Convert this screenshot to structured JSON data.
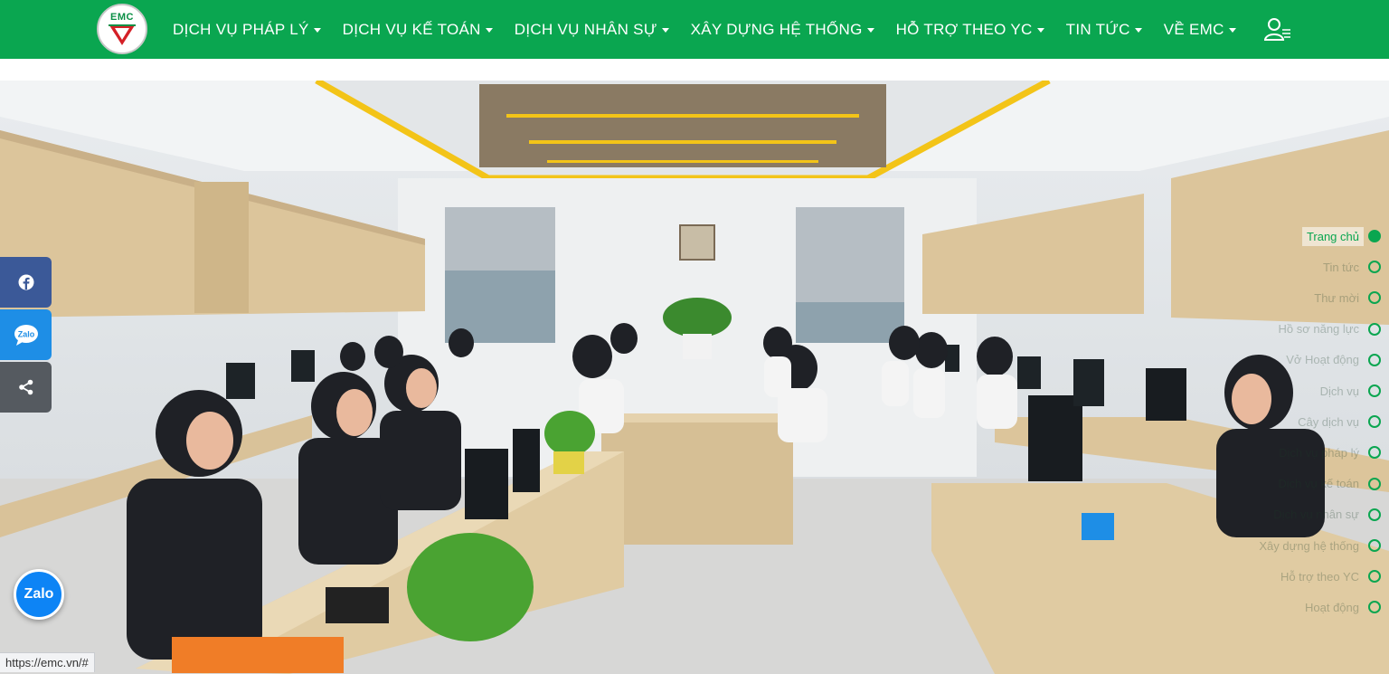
{
  "brand": {
    "logo_text": "EMC"
  },
  "nav": {
    "items": [
      {
        "label": "DỊCH VỤ PHÁP LÝ"
      },
      {
        "label": "DỊCH VỤ KẾ TOÁN"
      },
      {
        "label": "DỊCH VỤ NHÂN SỰ"
      },
      {
        "label": "XÂY DỰNG HỆ THỐNG"
      },
      {
        "label": "HỖ TRỢ THEO YC"
      },
      {
        "label": "TIN TỨC"
      },
      {
        "label": "VỀ EMC"
      }
    ],
    "user_icon": "user-menu-icon"
  },
  "social": {
    "facebook_icon": "facebook-icon",
    "zalo_label": "Zalo",
    "share_icon": "share-icon"
  },
  "zalo_float": {
    "label": "Zalo"
  },
  "dotnav": {
    "items": [
      {
        "label": "Trang chủ",
        "active": true
      },
      {
        "label": "Tin tức",
        "active": false
      },
      {
        "label": "Thư mời",
        "active": false
      },
      {
        "label": "Hồ sơ năng lực",
        "active": false
      },
      {
        "label": "Vở Hoạt động",
        "active": false
      },
      {
        "label": "Dịch vụ",
        "active": false
      },
      {
        "label": "Cây dịch vụ",
        "active": false
      },
      {
        "label": "Dịch vụ pháp lý",
        "active": false
      },
      {
        "label": "Dịch vụ kế toán",
        "active": false
      },
      {
        "label": "Dịch vụ nhân sự",
        "active": false
      },
      {
        "label": "Xây dựng hệ thống",
        "active": false
      },
      {
        "label": "Hỗ trợ theo YC",
        "active": false
      },
      {
        "label": "Hoạt động",
        "active": false
      }
    ]
  },
  "status": {
    "url": "https://emc.vn/#"
  },
  "colors": {
    "primary": "#0aa650",
    "facebook": "#3b5998",
    "zalo": "#1e8ee6",
    "share": "#555a60"
  }
}
